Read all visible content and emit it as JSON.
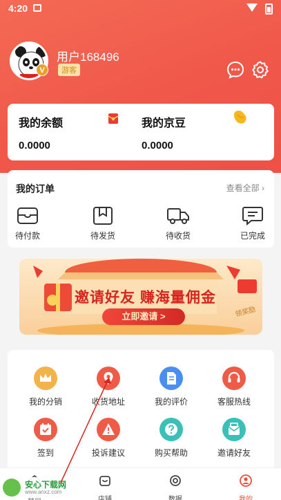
{
  "status_bar": {
    "time": "4:20"
  },
  "profile": {
    "username": "用户168496",
    "level_badge": "V",
    "role_badge": "游客",
    "icons": [
      "chat-bubble-icon",
      "gear-icon"
    ]
  },
  "balance": {
    "items": [
      {
        "title": "我的余额",
        "value": "0.0000",
        "icon": "red-envelope-icon"
      },
      {
        "title": "我的京豆",
        "value": "0.0000",
        "icon": "bean-icon"
      }
    ]
  },
  "orders": {
    "title": "我的订单",
    "view_all": "查看全部",
    "items": [
      {
        "label": "待付款",
        "icon": "wallet-icon"
      },
      {
        "label": "待发货",
        "icon": "box-icon"
      },
      {
        "label": "待收货",
        "icon": "truck-icon"
      },
      {
        "label": "已完成",
        "icon": "message-check-icon"
      }
    ]
  },
  "banner": {
    "title": "邀请好友 赚海量佣金",
    "button": "立即邀请 >",
    "tag": "领奖励"
  },
  "services": [
    {
      "label": "我的分销",
      "icon": "crown-icon",
      "color": "#f3b24a"
    },
    {
      "label": "收货地址",
      "icon": "location-icon",
      "color": "#ef5b46"
    },
    {
      "label": "我的评价",
      "icon": "document-icon",
      "color": "#4a8ef0"
    },
    {
      "label": "客服热线",
      "icon": "headset-icon",
      "color": "#ef5b46"
    },
    {
      "label": "签到",
      "icon": "calendar-check-icon",
      "color": "#ef5b46"
    },
    {
      "label": "投诉建议",
      "icon": "warning-icon",
      "color": "#ef5b46"
    },
    {
      "label": "购买帮助",
      "icon": "question-icon",
      "color": "#3ac0b8"
    },
    {
      "label": "邀请好友",
      "icon": "invite-icon",
      "color": "#3ac0b8"
    }
  ],
  "tabbar": {
    "items": [
      {
        "label": "首页",
        "icon": "home-icon",
        "active": false
      },
      {
        "label": "店铺",
        "icon": "store-icon",
        "active": false
      },
      {
        "label": "数据",
        "icon": "data-icon",
        "active": false
      },
      {
        "label": "我的",
        "icon": "user-icon",
        "active": true
      }
    ]
  },
  "watermark": {
    "title": "安心下载网",
    "url": "www.anxz.com"
  },
  "colors": {
    "accent": "#ee4d3b",
    "header": "#f0584a"
  }
}
